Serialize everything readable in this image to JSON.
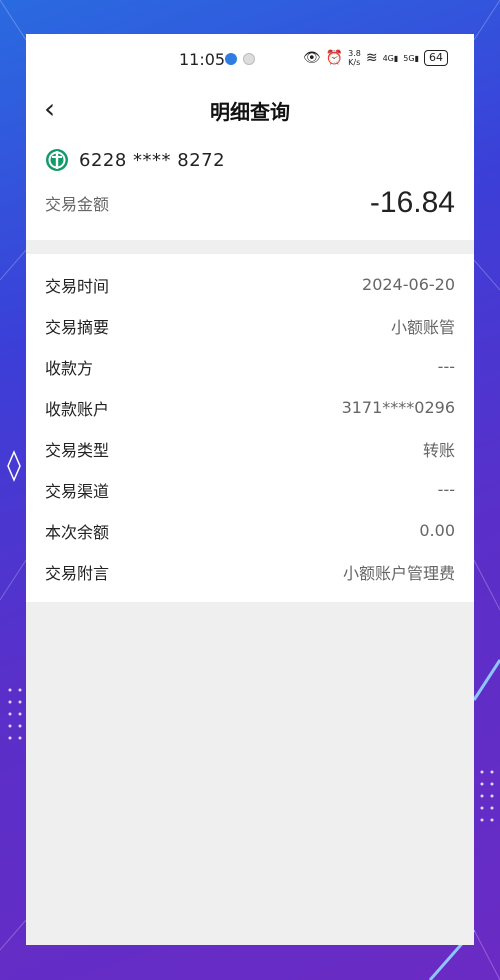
{
  "status_bar": {
    "time": "11:05",
    "network_speed_top": "3.8",
    "network_speed_unit": "K/s",
    "net1": "4G",
    "net2": "5G",
    "battery": "64"
  },
  "nav": {
    "back_icon": "chevron-left-icon",
    "title": "明细查询"
  },
  "account": {
    "bank_icon": "abc-bank-logo-icon",
    "number": "6228 **** 8272",
    "amount_label": "交易金额",
    "amount_value": "-16.84"
  },
  "details": [
    {
      "label": "交易时间",
      "value": "2024-06-20"
    },
    {
      "label": "交易摘要",
      "value": "小额账管"
    },
    {
      "label": "收款方",
      "value": "---"
    },
    {
      "label": "收款账户",
      "value": "3171****0296"
    },
    {
      "label": "交易类型",
      "value": "转账"
    },
    {
      "label": "交易渠道",
      "value": "---"
    },
    {
      "label": "本次余额",
      "value": "0.00"
    },
    {
      "label": "交易附言",
      "value": "小额账户管理费"
    }
  ],
  "colors": {
    "brand_green": "#139a6b",
    "background_gradient_start": "#2a6be0",
    "background_gradient_end": "#6a2bc4"
  }
}
